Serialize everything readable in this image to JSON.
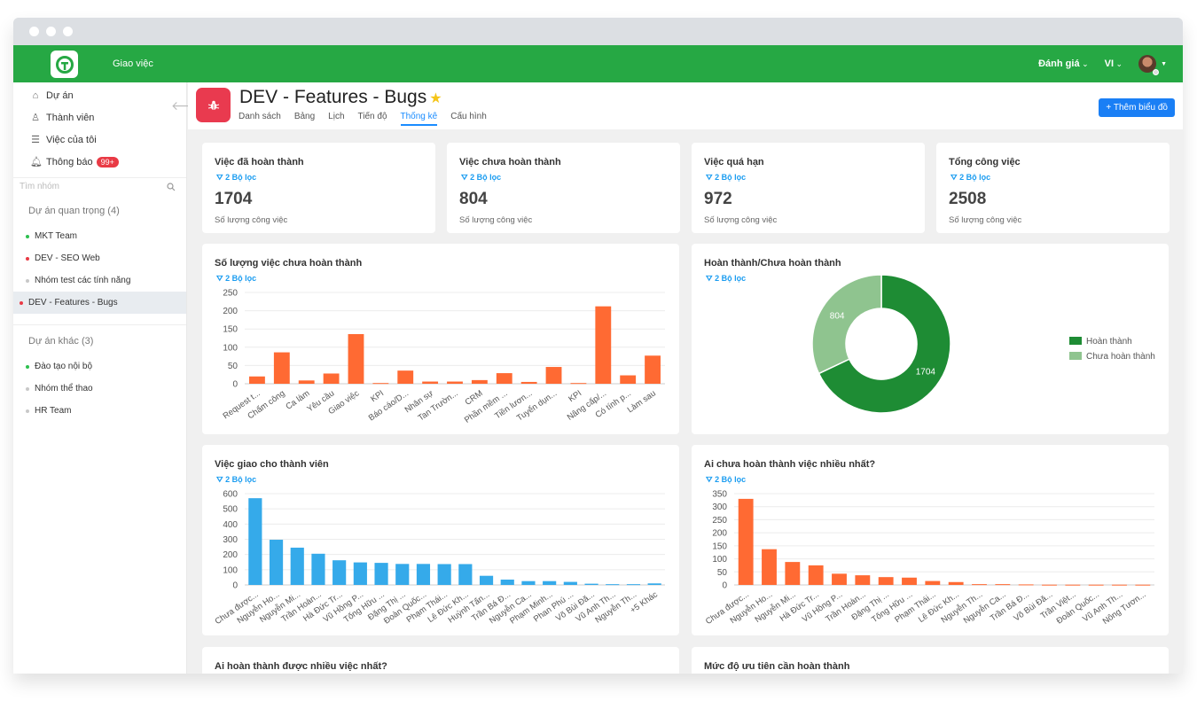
{
  "window": {
    "controls": [
      "close",
      "minimize",
      "maximize"
    ]
  },
  "topbar": {
    "logo_icon": "app-logo-icon",
    "nav_label": "Giao việc",
    "rating_label": "Đánh giá",
    "lang_label": "VI",
    "avatar_icon": "user-avatar"
  },
  "sidebar": {
    "nav": [
      {
        "label": "Dự án",
        "icon": "home-icon"
      },
      {
        "label": "Thành viên",
        "icon": "user-icon"
      },
      {
        "label": "Việc của tôi",
        "icon": "list-icon"
      },
      {
        "label": "Thông báo",
        "icon": "bell-icon",
        "badge": "99+"
      }
    ],
    "search_placeholder": "Tìm nhóm",
    "groups": [
      {
        "title": "Dự án quan trọng (4)",
        "projects": [
          {
            "name": "MKT Team",
            "color": "#2ec04f"
          },
          {
            "name": "DEV - SEO Web",
            "color": "#e93a45"
          },
          {
            "name": "Nhóm test các tính năng",
            "color": "#c8c8c8"
          },
          {
            "name": "DEV - Features - Bugs",
            "color": "#e93a45",
            "active": true
          }
        ]
      },
      {
        "title": "Dự án khác (3)",
        "projects": [
          {
            "name": "Đào tạo nội bộ",
            "color": "#2ec04f"
          },
          {
            "name": "Nhóm thể thao",
            "color": "#c8c8c8"
          },
          {
            "name": "HR Team",
            "color": "#c8c8c8"
          }
        ]
      }
    ]
  },
  "project": {
    "title": "DEV - Features - Bugs",
    "icon": "bug-icon",
    "starred": true,
    "tabs": [
      "Danh sách",
      "Bảng",
      "Lịch",
      "Tiến độ",
      "Thống kê",
      "Cấu hình"
    ],
    "active_tab": "Thống kê",
    "add_chart_label": "+ Thêm biểu đồ"
  },
  "filter_label": "2 Bộ lọc",
  "kpis": [
    {
      "title": "Việc đã hoàn thành",
      "value": "1704",
      "sub": "Số lượng công việc"
    },
    {
      "title": "Việc chưa hoàn thành",
      "value": "804",
      "sub": "Số lượng công việc"
    },
    {
      "title": "Việc quá hạn",
      "value": "972",
      "sub": "Số lượng công việc"
    },
    {
      "title": "Tổng công việc",
      "value": "2508",
      "sub": "Số lượng công việc"
    }
  ],
  "chart_data": [
    {
      "type": "bar",
      "title": "Số lượng việc chưa hoàn thành",
      "color": "#ff6a33",
      "categories": [
        "Request t...",
        "Chấm công",
        "Ca làm",
        "Yêu cầu",
        "Giao việc",
        "KPI",
        "Báo cáo/D...",
        "Nhân sự",
        "Tan Trườn...",
        "CRM",
        "Phần mềm ...",
        "Tiền lươn...",
        "Tuyển dụn...",
        "KPI",
        "Nâng cấp/...",
        "Có tính p...",
        "Làm sau"
      ],
      "values": [
        20,
        86,
        9,
        28,
        136,
        2,
        36,
        6,
        6,
        10,
        29,
        5,
        46,
        2,
        212,
        23,
        77
      ],
      "ylim": [
        0,
        250
      ],
      "yticks": [
        0,
        50,
        100,
        150,
        200,
        250
      ]
    },
    {
      "type": "pie",
      "title": "Hoàn thành/Chưa hoàn thành",
      "donut": true,
      "slices": [
        {
          "label": "Hoàn thành",
          "value": 1704,
          "color": "#1e8c34"
        },
        {
          "label": "Chưa hoàn thành",
          "value": 804,
          "color": "#8fc48f"
        }
      ],
      "legend": "right"
    },
    {
      "type": "bar",
      "title": "Việc giao cho thành viên",
      "color": "#35aaea",
      "categories": [
        "Chưa được...",
        "Nguyễn Ho...",
        "Nguyễn Mi...",
        "Trần Hoàn...",
        "Hà Đức Tr...",
        "Vũ Hồng P...",
        "Tống Hữu ...",
        "Đặng Thị ...",
        "Đoàn Quốc...",
        "Phạm Thái...",
        "Lê Đức Kh...",
        "Huỳnh Tấn...",
        "Trần Bá Đ...",
        "Nguyễn Ca...",
        "Phạm Minh...",
        "Phan Phú ...",
        "Võ Bùi Đă...",
        "Vũ Anh Th...",
        "Nguyễn Th...",
        "+5 Khác"
      ],
      "values": [
        570,
        297,
        245,
        205,
        162,
        148,
        145,
        138,
        138,
        137,
        137,
        60,
        35,
        25,
        25,
        20,
        8,
        5,
        5,
        10
      ],
      "ylim": [
        0,
        600
      ],
      "yticks": [
        0,
        100,
        200,
        300,
        400,
        500,
        600
      ]
    },
    {
      "type": "bar",
      "title": "Ai chưa hoàn thành việc nhiều nhất?",
      "color": "#ff6a33",
      "categories": [
        "Chưa được...",
        "Nguyễn Ho...",
        "Nguyễn Mi...",
        "Hà Đức Tr...",
        "Vũ Hồng P...",
        "Trần Hoàn...",
        "Đặng Thị ...",
        "Tống Hữu ...",
        "Phạm Thái...",
        "Lê Đức Kh...",
        "Nguyễn Th...",
        "Nguyễn Ca...",
        "Trần Bá Đ...",
        "Võ Bùi Đă...",
        "Trần Việt...",
        "Đoàn Quốc...",
        "Vũ Anh Th...",
        "Nông Tươn..."
      ],
      "values": [
        330,
        137,
        88,
        75,
        43,
        37,
        30,
        28,
        15,
        11,
        3,
        3,
        2,
        1,
        1,
        1,
        1,
        1
      ],
      "ylim": [
        0,
        350
      ],
      "yticks": [
        0,
        50,
        100,
        150,
        200,
        250,
        300,
        350
      ]
    }
  ],
  "bottom_cards": [
    "Ai hoàn thành được nhiều việc nhất?",
    "Mức độ ưu tiên cần hoàn thành"
  ]
}
